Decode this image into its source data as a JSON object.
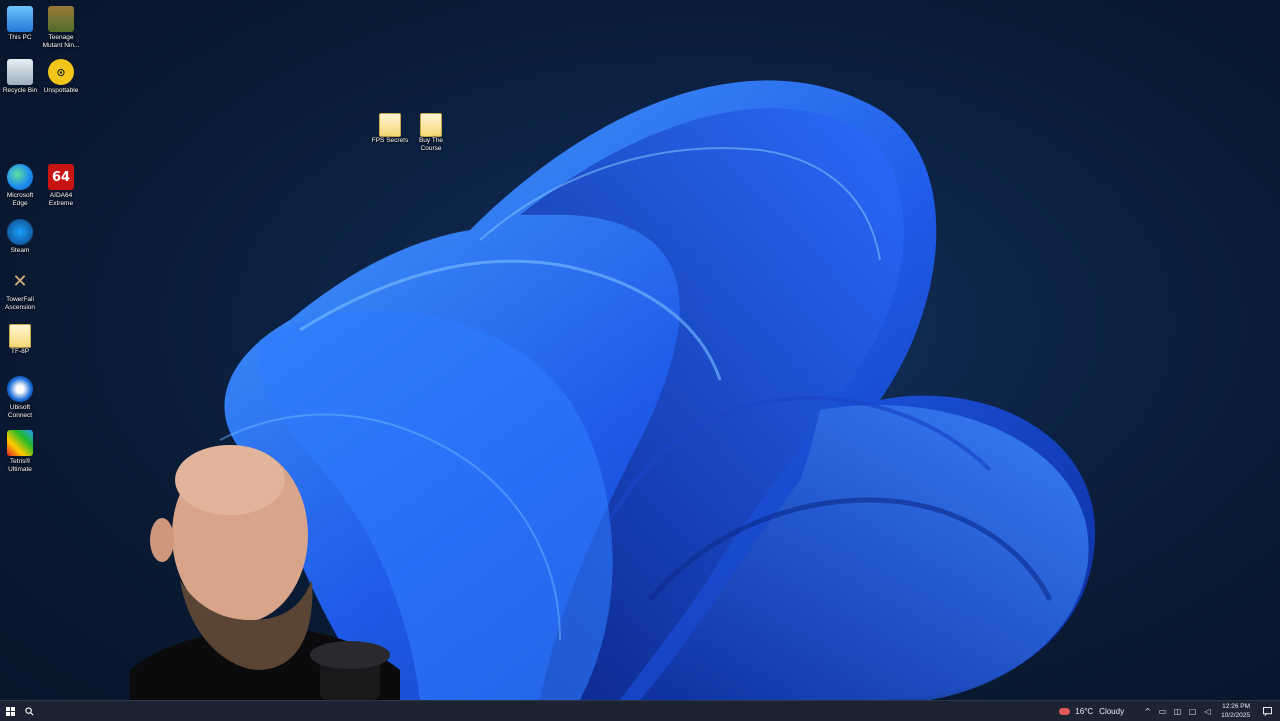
{
  "desktop": {
    "icons": [
      {
        "label": "This PC",
        "icon": "this-pc-icon"
      },
      {
        "label": "Teenage Mutant Nin...",
        "icon": "game-tmnt-icon"
      },
      {
        "label": "Recycle Bin",
        "icon": "recycle-bin-icon"
      },
      {
        "label": "Unspottable",
        "icon": "game-unspottable-icon"
      },
      {
        "label": "FPS Secrets",
        "icon": "folder-icon"
      },
      {
        "label": "Buy The Course",
        "icon": "folder-icon"
      },
      {
        "label": "Microsoft Edge",
        "icon": "edge-icon"
      },
      {
        "label": "AIDA64 Extreme",
        "icon": "aida64-icon",
        "badge": "64"
      },
      {
        "label": "Steam",
        "icon": "steam-icon"
      },
      {
        "label": "TowerFall Ascension",
        "icon": "towerfall-icon"
      },
      {
        "label": "TF-8P",
        "icon": "folder-icon"
      },
      {
        "label": "Ubisoft Connect",
        "icon": "ubisoft-icon"
      },
      {
        "label": "Tetris® Ultimate",
        "icon": "tetris-icon"
      }
    ]
  },
  "taskbar": {
    "start_icon": "windows-start-icon",
    "search_icon": "search-icon",
    "weather": {
      "temp": "16°C",
      "condition": "Cloudy",
      "icon": "weather-cloud-icon"
    },
    "clock": {
      "time": "12:26 PM",
      "date": "10/2/2025"
    },
    "tray_icons": [
      "chevron-up-icon",
      "battery-icon",
      "network-icon",
      "display-icon",
      "volume-icon"
    ],
    "notification_icon": "notification-icon"
  },
  "colors": {
    "background": "#0a1a33",
    "bloom_primary": "#1f5be8",
    "bloom_light": "#3d8bff",
    "taskbar": "#1c2433"
  }
}
